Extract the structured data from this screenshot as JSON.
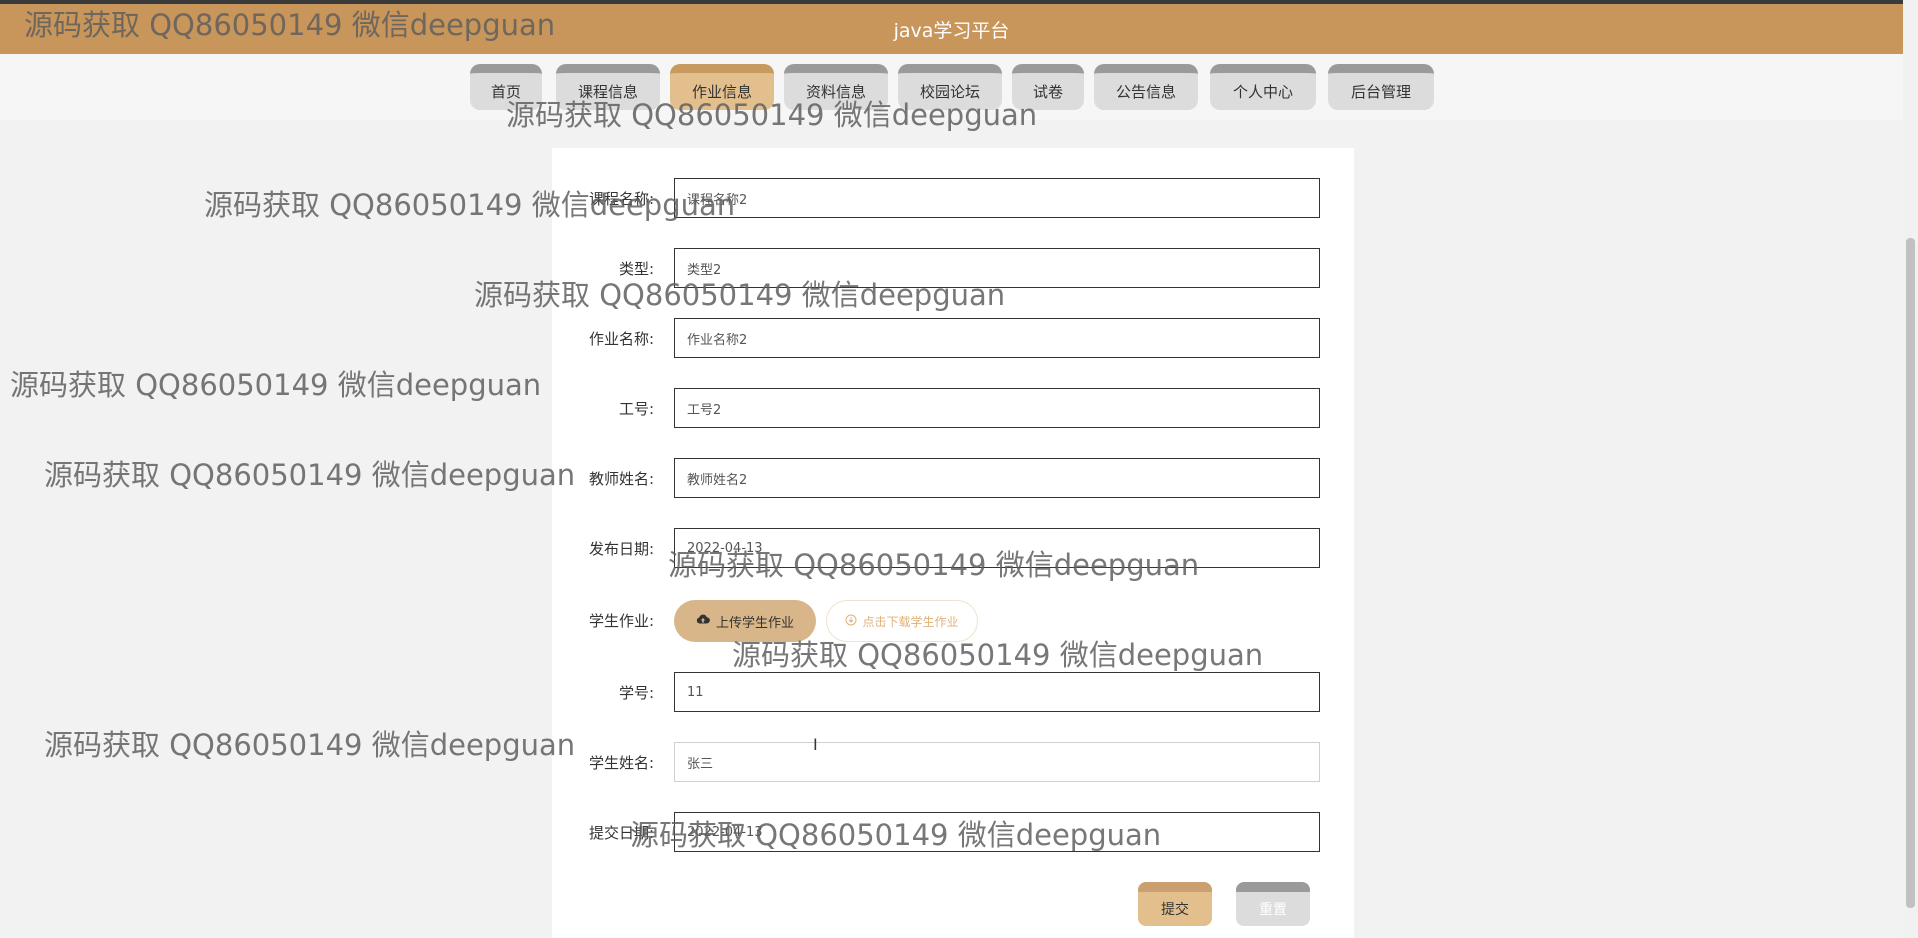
{
  "app": {
    "title": "java学习平台"
  },
  "nav": {
    "items": [
      {
        "label": "首页"
      },
      {
        "label": "课程信息"
      },
      {
        "label": "作业信息"
      },
      {
        "label": "资料信息"
      },
      {
        "label": "校园论坛"
      },
      {
        "label": "试卷"
      },
      {
        "label": "公告信息"
      },
      {
        "label": "个人中心"
      },
      {
        "label": "后台管理"
      }
    ],
    "active": "作业信息"
  },
  "form": {
    "course_name": {
      "label": "课程名称:",
      "value": "课程名称2"
    },
    "type": {
      "label": "类型:",
      "value": "类型2"
    },
    "homework_name": {
      "label": "作业名称:",
      "value": "作业名称2"
    },
    "staff_id": {
      "label": "工号:",
      "value": "工号2"
    },
    "teacher_name": {
      "label": "教师姓名:",
      "value": "教师姓名2"
    },
    "publish_date": {
      "label": "发布日期:",
      "value": "2022-04-13"
    },
    "student_homework": {
      "label": "学生作业:",
      "upload_label": "上传学生作业",
      "download_label": "点击下载学生作业"
    },
    "student_id": {
      "label": "学号:",
      "value": "11"
    },
    "student_name": {
      "label": "学生姓名:",
      "value": "张三"
    },
    "submit_date": {
      "label": "提交日期:",
      "value": "2022-04-13"
    }
  },
  "buttons": {
    "submit": "提交",
    "reset": "重置"
  },
  "watermark": "源码获取 QQ86050149 微信deepguan"
}
